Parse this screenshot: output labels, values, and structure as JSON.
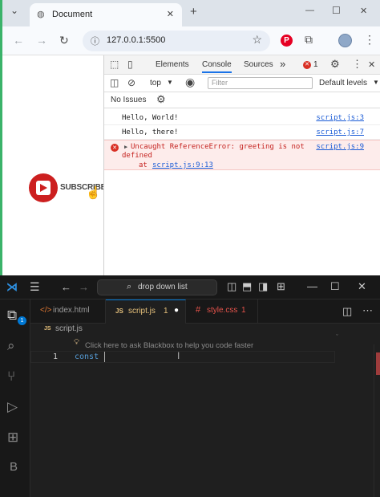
{
  "browser": {
    "tab_title": "Document",
    "tab_close": "✕",
    "new_tab": "+",
    "window_controls": [
      "—",
      "☐",
      "✕"
    ],
    "url": "127.0.0.1:5500"
  },
  "page": {
    "subscribe_label": "SUBSCRIBED"
  },
  "devtools": {
    "tabs": [
      "Elements",
      "Console",
      "Sources"
    ],
    "more_tabs": "»",
    "error_count": "1",
    "context_select": "top",
    "filter_placeholder": "Filter",
    "levels_select": "Default levels",
    "issues_label": "No Issues",
    "logs": [
      {
        "text": "Hello, World!",
        "source": "script.js:3"
      },
      {
        "text": "Hello, there!",
        "source": "script.js:7"
      }
    ],
    "error": {
      "line1": "Uncaught ReferenceError: greeting is not",
      "line2": "defined",
      "at_prefix": "at ",
      "at_link": "script.js:9:13",
      "source": "script.js:9"
    }
  },
  "vscode": {
    "search_text": "drop down list",
    "tabs": [
      {
        "label": "index.html",
        "badge": ""
      },
      {
        "label": "script.js",
        "badge": "1"
      },
      {
        "label": "style.css",
        "badge": "1"
      }
    ],
    "breadcrumb": "script.js",
    "hint": "Click here to ask Blackbox to help you code faster",
    "line_number": "1",
    "code": "const ",
    "activity_letter": "B"
  },
  "colors": {
    "devtools_accent": "#1a73e8",
    "error_bg": "#fdeceb",
    "error_text": "#c5221f",
    "vscode_bg": "#1f1f1f",
    "vscode_accent": "#0078d4",
    "js_badge": "#e5c07b",
    "css_tab": "#e5534b",
    "youtube_red": "#cc1f1f"
  }
}
